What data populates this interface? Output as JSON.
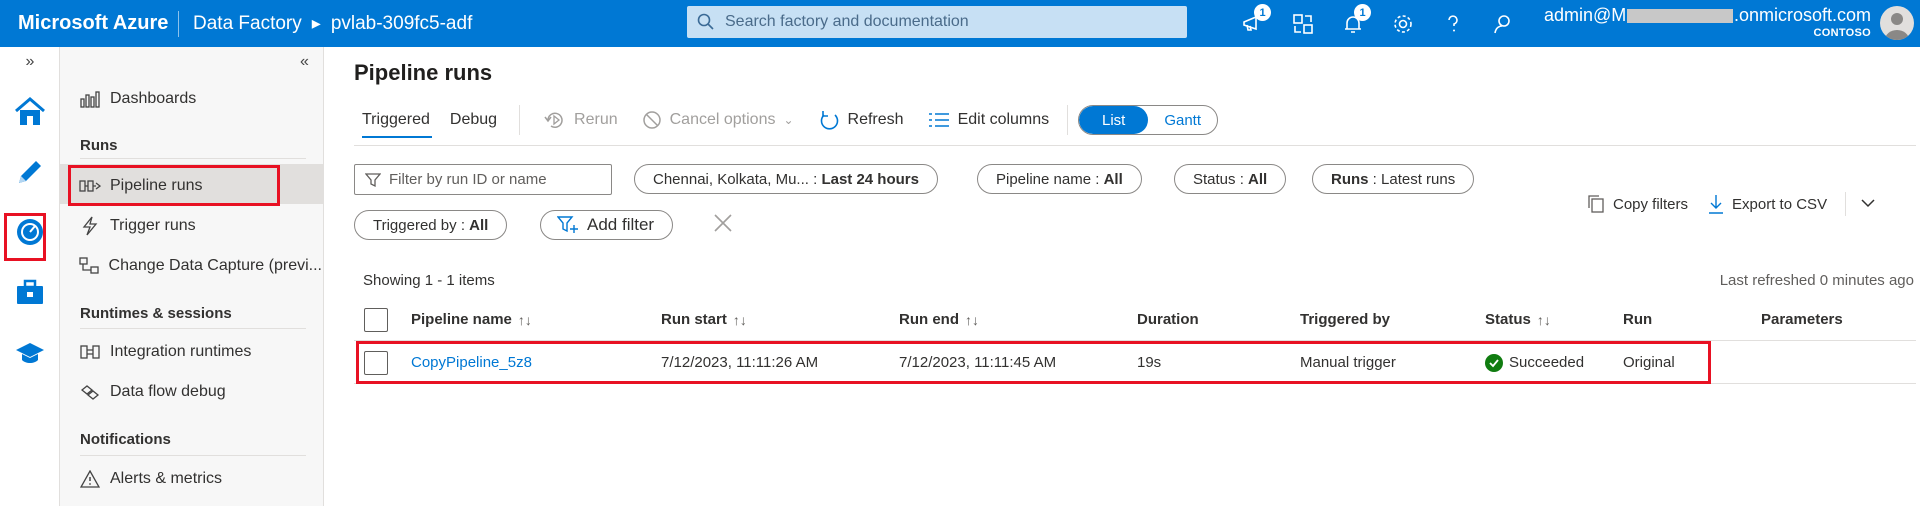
{
  "topbar": {
    "brand": "Microsoft Azure",
    "breadcrumb": [
      "Data Factory",
      "pvlab-309fc5-adf"
    ],
    "search_placeholder": "Search factory and documentation",
    "badges": [
      "1",
      "1"
    ],
    "account_email_prefix": "admin@M",
    "account_email_suffix": ".onmicrosoft.com",
    "tenant": "CONTOSO"
  },
  "nav": {
    "dashboards": "Dashboards",
    "section_runs": "Runs",
    "pipeline_runs": "Pipeline runs",
    "trigger_runs": "Trigger runs",
    "change_data_capture": "Change Data Capture (previ...",
    "section_runtimes": "Runtimes & sessions",
    "integration_runtimes": "Integration runtimes",
    "data_flow_debug": "Data flow debug",
    "section_notifications": "Notifications",
    "alerts_metrics": "Alerts & metrics"
  },
  "main": {
    "title": "Pipeline runs",
    "tabs": [
      "Triggered",
      "Debug"
    ],
    "buttons": {
      "rerun": "Rerun",
      "cancel_options": "Cancel options",
      "refresh": "Refresh",
      "edit_columns": "Edit columns"
    },
    "view_toggle": [
      "List",
      "Gantt"
    ],
    "filter_placeholder": "Filter by run ID or name",
    "pills": {
      "timezone_label": "Chennai, Kolkata, Mu... :",
      "timezone_value": "Last 24 hours",
      "pipeline_label": "Pipeline name :",
      "pipeline_value": "All",
      "status_label": "Status :",
      "status_value": "All",
      "runs_label": "Runs",
      "runs_value": ": Latest runs",
      "triggered_label": "Triggered by :",
      "triggered_value": "All",
      "add_filter": "Add filter"
    },
    "copy_filters": "Copy filters",
    "export_csv": "Export to CSV",
    "showing": "Showing 1 - 1 items",
    "last_refreshed": "Last refreshed 0 minutes ago",
    "columns": [
      "Pipeline name",
      "Run start",
      "Run end",
      "Duration",
      "Triggered by",
      "Status",
      "Run",
      "Parameters"
    ],
    "rows": [
      {
        "pipeline_name": "CopyPipeline_5z8",
        "run_start": "7/12/2023, 11:11:26 AM",
        "run_end": "7/12/2023, 11:11:45 AM",
        "duration": "19s",
        "triggered_by": "Manual trigger",
        "status": "Succeeded",
        "run": "Original",
        "parameters": ""
      }
    ]
  },
  "colors": {
    "accent": "#0078d4",
    "highlight": "#e81123",
    "success": "#107c10"
  }
}
